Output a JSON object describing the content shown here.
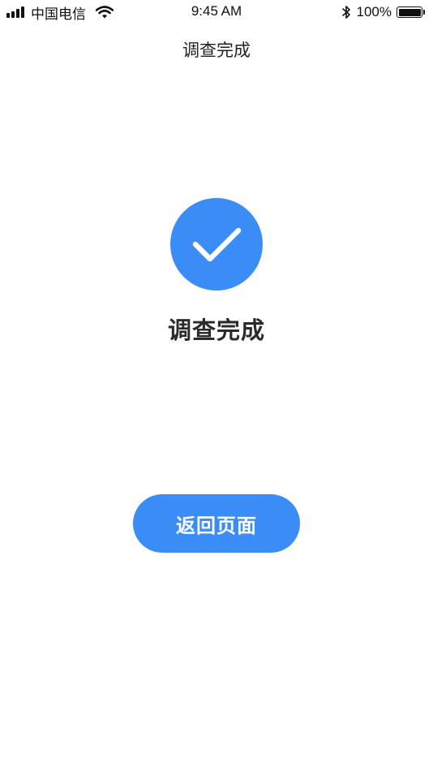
{
  "status_bar": {
    "carrier": "中国电信",
    "time": "9:45 AM",
    "battery_percent": "100%",
    "icons": [
      "signal-icon",
      "wifi-icon",
      "bluetooth-icon",
      "battery-icon"
    ]
  },
  "nav": {
    "title": "调查完成"
  },
  "result": {
    "icon": "checkmark-icon",
    "title": "调查完成"
  },
  "actions": {
    "return_label": "返回页面"
  },
  "colors": {
    "accent": "#3a8cf6",
    "text": "#2b2b2b",
    "background": "#ffffff"
  }
}
